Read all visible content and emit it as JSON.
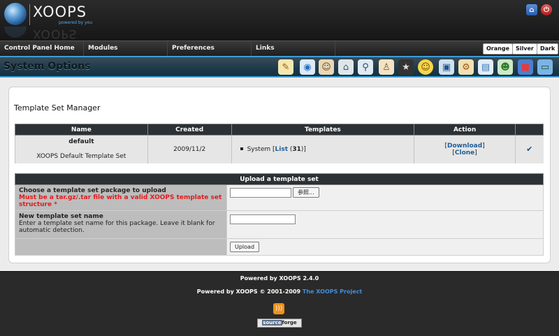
{
  "header": {
    "logo_text": "XOOPS",
    "logo_tagline": "powered by you",
    "home_icon": "home-icon",
    "logout_icon": "power-icon"
  },
  "menu": {
    "items": [
      "Control Panel Home",
      "Modules",
      "Preferences",
      "Links"
    ],
    "themes": [
      "Orange",
      "Silver",
      "Dark"
    ]
  },
  "system_bar": {
    "title": "System Options",
    "icons": [
      "edit-icon",
      "globe-icon",
      "users-icon",
      "house-icon",
      "search-icon",
      "person-icon",
      "star-icon",
      "smile-icon",
      "monitor-icon",
      "gear-icon",
      "image-icon",
      "group-icon",
      "blocks-icon",
      "screen-icon"
    ]
  },
  "page": {
    "title": "Template Set Manager"
  },
  "templates_table": {
    "headers": [
      "Name",
      "Created",
      "Templates",
      "Action"
    ],
    "row": {
      "name": "default",
      "description": "XOOPS Default Template Set",
      "created": "2009/11/2",
      "template_module": "System",
      "list_label": "List",
      "list_count": "31",
      "download_label": "Download",
      "clone_label": "Clone",
      "status_icon": "checkmark-icon"
    }
  },
  "upload_form": {
    "title": "Upload a template set",
    "package_label": "Choose a template set package to upload",
    "package_note": "Must be a tar.gz/.tar file with a valid XOOPS template set structure *",
    "browse_label": "参照...",
    "name_label": "New template set name",
    "name_help": "Enter a template set name for this package. Leave it blank for automatic detection.",
    "name_value": "",
    "submit_label": "Upload"
  },
  "footer": {
    "powered": "Powered by XOOPS 2.4.0",
    "copyright": "Powered by XOOPS © 2001-2009",
    "project_link": "The XOOPS Project",
    "sf_text_a": "source",
    "sf_text_b": "forge",
    "rss_icon": "rss-icon"
  }
}
